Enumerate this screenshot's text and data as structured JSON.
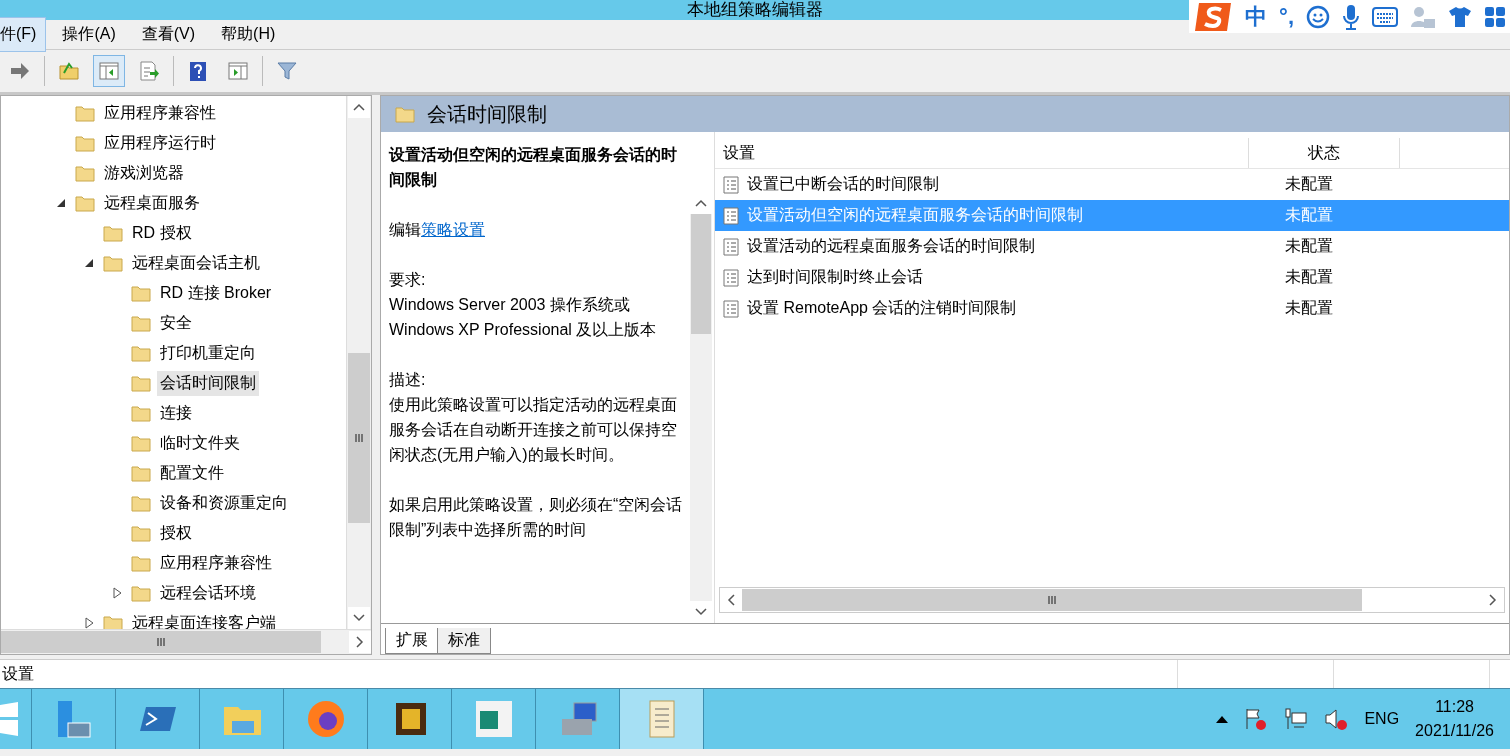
{
  "window": {
    "title": "本地组策略编辑器"
  },
  "menu": [
    {
      "label": "件(F)",
      "selected": true
    },
    {
      "label": "操作(A)",
      "selected": false
    },
    {
      "label": "查看(V)",
      "selected": false
    },
    {
      "label": "帮助(H)",
      "selected": false
    }
  ],
  "toolbar": [
    {
      "pressed": false
    },
    {
      "pressed": false
    },
    {
      "pressed": true
    },
    {
      "pressed": false
    },
    {
      "pressed": false
    },
    {
      "pressed": false
    },
    {
      "pressed": false
    }
  ],
  "ime_bar": {
    "mode": "中",
    "punctuation": "°,"
  },
  "tree": [
    {
      "label": "应用程序兼容性",
      "selected": false
    },
    {
      "label": "应用程序运行时",
      "selected": false
    },
    {
      "label": "游戏浏览器",
      "selected": false
    },
    {
      "label": "远程桌面服务",
      "selected": false,
      "expanded": true,
      "children": [
        {
          "label": "RD 授权",
          "selected": false
        },
        {
          "label": "远程桌面会话主机",
          "selected": false,
          "expanded": true,
          "children": [
            {
              "label": "RD 连接 Broker",
              "selected": false
            },
            {
              "label": "安全",
              "selected": false
            },
            {
              "label": "打印机重定向",
              "selected": false
            },
            {
              "label": "会话时间限制",
              "selected": true
            },
            {
              "label": "连接",
              "selected": false
            },
            {
              "label": "临时文件夹",
              "selected": false
            },
            {
              "label": "配置文件",
              "selected": false
            },
            {
              "label": "设备和资源重定向",
              "selected": false
            },
            {
              "label": "授权",
              "selected": false
            },
            {
              "label": "应用程序兼容性",
              "selected": false
            },
            {
              "label": "远程会话环境",
              "selected": false,
              "expanded": false
            }
          ]
        },
        {
          "label": "远程桌面连接客户端",
          "selected": false,
          "expanded": false
        }
      ]
    }
  ],
  "panel": {
    "title": "会话时间限制",
    "description": {
      "heading": "设置活动但空闲的远程桌面服务会话的时间限制",
      "edit_prefix": "编辑",
      "edit_link": "策略设置",
      "requirements_label": "要求:",
      "requirements": "Windows Server 2003 操作系统或 Windows XP Professional 及以上版本",
      "description_label": "描述:",
      "description": "使用此策略设置可以指定活动的远程桌面服务会话在自动断开连接之前可以保持空闲状态(无用户输入)的最长时间。",
      "more": "如果启用此策略设置，则必须在“空闲会话限制”列表中选择所需的时间"
    },
    "table": {
      "columns": [
        "设置",
        "状态"
      ],
      "rows": [
        {
          "setting": "设置已中断会话的时间限制",
          "state": "未配置",
          "selected": false
        },
        {
          "setting": "设置活动但空闲的远程桌面服务会话的时间限制",
          "state": "未配置",
          "selected": true
        },
        {
          "setting": "设置活动的远程桌面服务会话的时间限制",
          "state": "未配置",
          "selected": false
        },
        {
          "setting": "达到时间限制时终止会话",
          "state": "未配置",
          "selected": false
        },
        {
          "setting": "设置 RemoteApp 会话的注销时间限制",
          "state": "未配置",
          "selected": false
        }
      ]
    },
    "tabs": [
      {
        "label": "扩展",
        "selected": true
      },
      {
        "label": "标准",
        "selected": false
      }
    ]
  },
  "status_bar": {
    "text": "设置"
  },
  "taskbar": {
    "apps": [
      {
        "active": false
      },
      {
        "active": false
      },
      {
        "active": false
      },
      {
        "active": false
      },
      {
        "active": false
      },
      {
        "active": false
      },
      {
        "active": false
      },
      {
        "active": true
      }
    ],
    "language": "ENG",
    "time": "11:28",
    "date": "2021/11/26"
  }
}
